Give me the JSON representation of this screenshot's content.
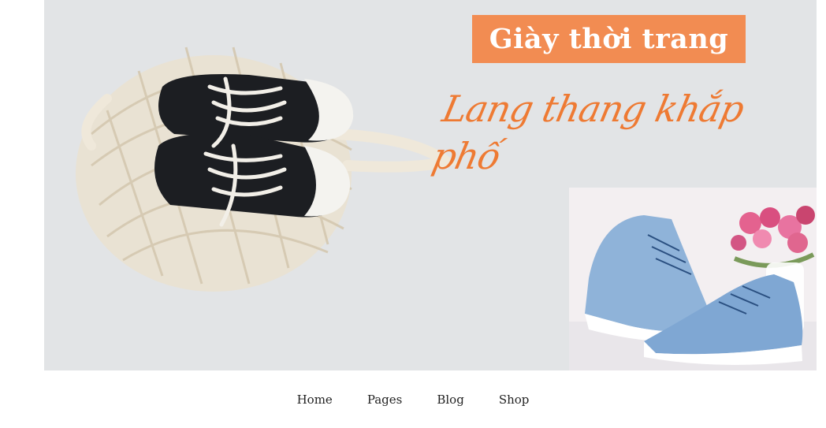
{
  "hero": {
    "title": "Giày thời trang",
    "subtitle": "Lang thang khắp phố",
    "image_left": "black-sneakers-in-mesh-bag",
    "image_right": "blue-denim-high-top-sneakers-with-flowers",
    "colors": {
      "accent": "#f28c52",
      "script": "#ee7a33",
      "background": "#e2e4e6"
    }
  },
  "nav": {
    "items": [
      {
        "label": "Home"
      },
      {
        "label": "Pages"
      },
      {
        "label": "Blog"
      },
      {
        "label": "Shop"
      }
    ]
  }
}
